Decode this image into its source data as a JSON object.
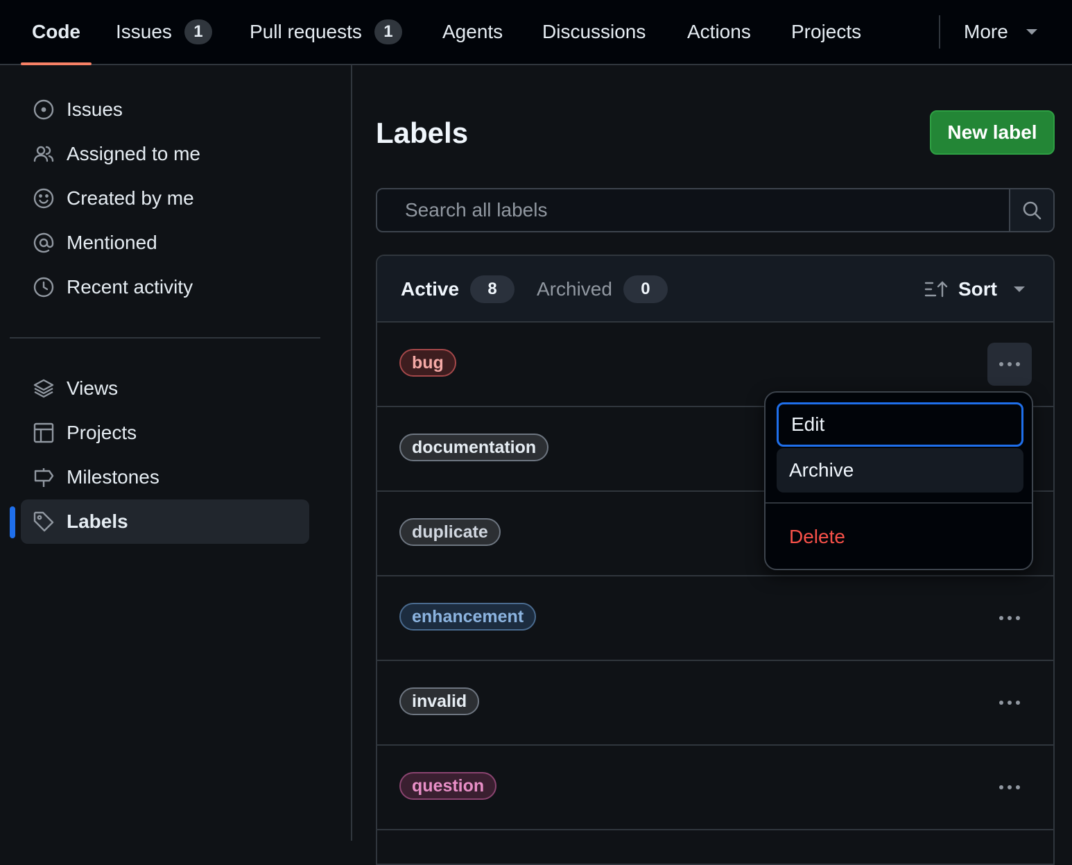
{
  "topnav": {
    "tabs": [
      {
        "label": "Code",
        "count": null
      },
      {
        "label": "Issues",
        "count": "1"
      },
      {
        "label": "Pull requests",
        "count": "1"
      },
      {
        "label": "Agents",
        "count": null
      },
      {
        "label": "Discussions",
        "count": null
      },
      {
        "label": "Actions",
        "count": null
      },
      {
        "label": "Projects",
        "count": null
      }
    ],
    "more_label": "More",
    "active_tab": "Code",
    "active_underline_color": "#f78166"
  },
  "sidebar": {
    "items": [
      {
        "label": "Issues",
        "icon": "issue-opened-icon"
      },
      {
        "label": "Assigned to me",
        "icon": "people-icon"
      },
      {
        "label": "Created by me",
        "icon": "smiley-icon"
      },
      {
        "label": "Mentioned",
        "icon": "mention-icon"
      },
      {
        "label": "Recent activity",
        "icon": "clock-icon"
      }
    ],
    "items2": [
      {
        "label": "Views",
        "icon": "stack-icon"
      },
      {
        "label": "Projects",
        "icon": "table-icon"
      },
      {
        "label": "Milestones",
        "icon": "milestone-icon"
      },
      {
        "label": "Labels",
        "icon": "tag-icon"
      }
    ],
    "active_item": "Labels",
    "indicator_color": "#1f6feb"
  },
  "main": {
    "title": "Labels",
    "new_label_button": "New label",
    "search": {
      "placeholder": "Search all labels",
      "value": ""
    },
    "filters": {
      "active_label": "Active",
      "active_count": "8",
      "archived_label": "Archived",
      "archived_count": "0"
    },
    "sort_label": "Sort",
    "labels": [
      {
        "name": "bug",
        "bg": "#3d1d1f",
        "border": "#a5484a",
        "text": "#f4a9a6"
      },
      {
        "name": "documentation",
        "bg": "#2c2f33",
        "border": "#6e7681",
        "text": "#e6edf3"
      },
      {
        "name": "duplicate",
        "bg": "#2c2f33",
        "border": "#6e7681",
        "text": "#d1d7e0"
      },
      {
        "name": "enhancement",
        "bg": "#1c2c3f",
        "border": "#4a6b8f",
        "text": "#8cb4e0"
      },
      {
        "name": "invalid",
        "bg": "#2c2f33",
        "border": "#6e7681",
        "text": "#e6edf3"
      },
      {
        "name": "question",
        "bg": "#3a1f30",
        "border": "#8a4470",
        "text": "#e88fc7"
      }
    ]
  },
  "menu": {
    "edit": "Edit",
    "archive": "Archive",
    "delete": "Delete",
    "delete_color": "#f85149",
    "focus_color": "#1f6feb"
  },
  "colors": {
    "accent_green": "#238636",
    "background": "#0f1216",
    "border": "#30363d"
  }
}
